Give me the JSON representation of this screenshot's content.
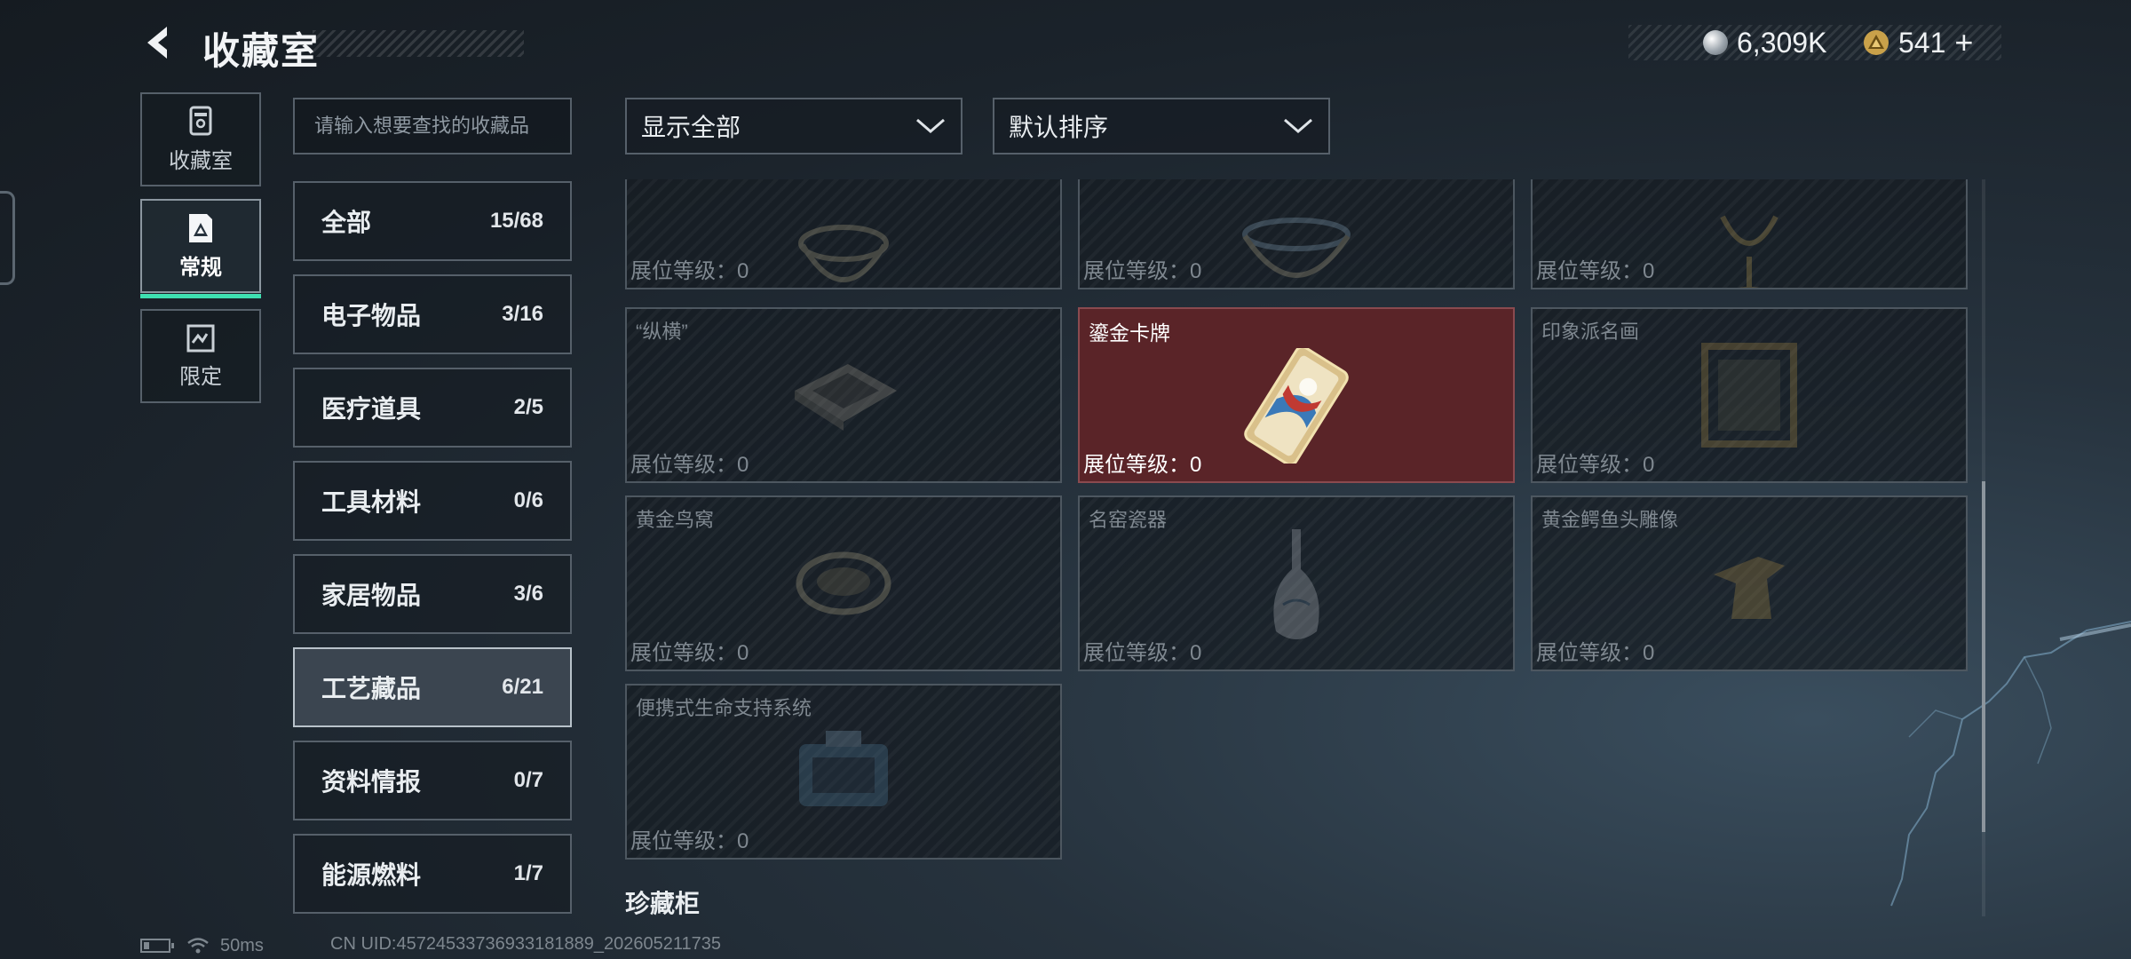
{
  "header": {
    "title": "收藏室",
    "silver_amount": "6,309K",
    "gold_amount": "541"
  },
  "side_tabs": [
    {
      "label": "收藏室",
      "icon": "collection-room-icon",
      "active": false
    },
    {
      "label": "常规",
      "icon": "regular-icon",
      "active": true
    },
    {
      "label": "限定",
      "icon": "limited-icon",
      "active": false
    }
  ],
  "search": {
    "placeholder": "请输入想要查找的收藏品"
  },
  "categories": [
    {
      "name": "全部",
      "count": "15/68"
    },
    {
      "name": "电子物品",
      "count": "3/16"
    },
    {
      "name": "医疗道具",
      "count": "2/5"
    },
    {
      "name": "工具材料",
      "count": "0/6"
    },
    {
      "name": "家居物品",
      "count": "3/6"
    },
    {
      "name": "工艺藏品",
      "count": "6/21",
      "selected": true
    },
    {
      "name": "资料情报",
      "count": "0/7"
    },
    {
      "name": "能源燃料",
      "count": "1/7"
    }
  ],
  "filters": {
    "show": "显示全部",
    "sort": "默认排序"
  },
  "grid": {
    "items": [
      {
        "name": "",
        "level": "展位等级：0",
        "icon": "bowl-icon"
      },
      {
        "name": "",
        "level": "展位等级：0",
        "icon": "cauldron-icon"
      },
      {
        "name": "",
        "level": "展位等级：0",
        "icon": "goblet-icon"
      },
      {
        "name": "“纵横”",
        "level": "展位等级：0",
        "icon": "chessboard-icon"
      },
      {
        "name": "鎏金卡牌",
        "level": "展位等级：0",
        "icon": "gilded-card-icon",
        "unlocked": true
      },
      {
        "name": "印象派名画",
        "level": "展位等级：0",
        "icon": "painting-icon"
      },
      {
        "name": "黄金鸟窝",
        "level": "展位等级：0",
        "icon": "bird-nest-icon"
      },
      {
        "name": "名窑瓷器",
        "level": "展位等级：0",
        "icon": "porcelain-vase-icon"
      },
      {
        "name": "黄金鳄鱼头雕像",
        "level": "展位等级：0",
        "icon": "crocodile-statue-icon"
      },
      {
        "name": "便携式生命支持系统",
        "level": "展位等级：0",
        "icon": "life-support-icon"
      }
    ]
  },
  "section_title": "珍藏柜",
  "status": {
    "ping": "50ms",
    "uid": "CN UID:4572453373693318​1889_202605211735"
  },
  "colors": {
    "accent": "#3ee0b1",
    "unlocked_card": "#5a2428"
  }
}
